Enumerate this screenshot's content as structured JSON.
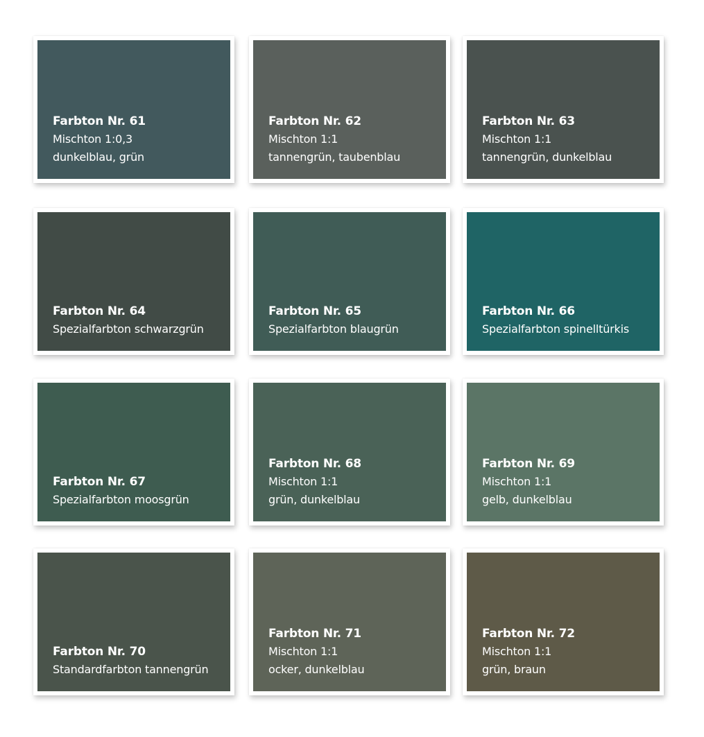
{
  "swatches": [
    {
      "title": "Farbton Nr. 61",
      "line1": "Mischton 1:0,3",
      "line2": "dunkelblau, grün",
      "color": "#42595d"
    },
    {
      "title": "Farbton Nr. 62",
      "line1": "Mischton 1:1",
      "line2": "tannengrün, taubenblau",
      "color": "#5a605c"
    },
    {
      "title": "Farbton Nr. 63",
      "line1": "Mischton 1:1",
      "line2": "tannengrün, dunkelblau",
      "color": "#4a524f"
    },
    {
      "title": "Farbton Nr. 64",
      "line1": "Spezialfarbton schwarzgrün",
      "line2": "",
      "color": "#414b46"
    },
    {
      "title": "Farbton Nr. 65",
      "line1": "Spezialfarbton blaugrün",
      "line2": "",
      "color": "#405c56"
    },
    {
      "title": "Farbton Nr. 66",
      "line1": "Spezialfarbton spinelltürkis",
      "line2": "",
      "color": "#1f6465"
    },
    {
      "title": "Farbton Nr. 67",
      "line1": "Spezialfarbton moosgrün",
      "line2": "",
      "color": "#3e5c50"
    },
    {
      "title": "Farbton Nr. 68",
      "line1": "Mischton 1:1",
      "line2": "grün, dunkelblau",
      "color": "#4a6257"
    },
    {
      "title": "Farbton Nr. 69",
      "line1": "Mischton 1:1",
      "line2": "gelb, dunkelblau",
      "color": "#5b7566"
    },
    {
      "title": "Farbton Nr. 70",
      "line1": "Standardfarbton tannengrün",
      "line2": "",
      "color": "#4a544b"
    },
    {
      "title": "Farbton Nr. 71",
      "line1": "Mischton 1:1",
      "line2": "ocker, dunkelblau",
      "color": "#5e6458"
    },
    {
      "title": "Farbton Nr. 72",
      "line1": "Mischton 1:1",
      "line2": "grün, braun",
      "color": "#5e5a48"
    }
  ]
}
